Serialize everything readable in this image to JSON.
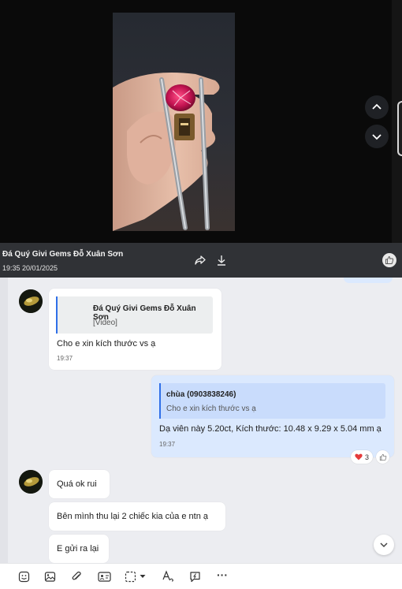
{
  "viewer": {
    "sender_name": "Đá Quý Givi Gems Đỗ Xuân Sơn",
    "sent_time": "19:35 20/01/2025",
    "icons": [
      "share-icon",
      "download-icon",
      "like-icon",
      "chevron-up-icon",
      "chevron-down-icon"
    ]
  },
  "messages": [
    {
      "quote_author": "Đá Quý Givi Gems Đỗ Xuân Sơn",
      "quote_text": "[Video]",
      "text": "Cho e xin kích thước vs ạ",
      "time": "19:37"
    },
    {
      "quote_author": "chùa (0903838246)",
      "quote_text": "Cho e xin kích thước vs ạ",
      "text": "Dạ viên này 5.20ct, Kích thước: 10.48 x 9.29 x 5.04 mm ạ",
      "time": "19:37",
      "reaction_count": "3"
    },
    {
      "text": "Quá ok rui"
    },
    {
      "text": "Bên mình thu lại 2 chiếc kia của e ntn ạ"
    },
    {
      "text": "E gửi ra lại"
    }
  ],
  "toolbar": {
    "icons": [
      "sticker-icon",
      "image-icon",
      "attachment-icon",
      "contact-card-icon",
      "screenshot-icon",
      "dropdown-caret-icon",
      "text-format-icon",
      "quick-message-icon",
      "more-icon"
    ],
    "more_label": "···"
  },
  "colors": {
    "viewer_bg": "#0a0a0a",
    "footer_bg": "#303236",
    "chat_bg": "#ecedf1",
    "my_bubble": "#dbe9fe",
    "accent": "#2f6fe8"
  }
}
